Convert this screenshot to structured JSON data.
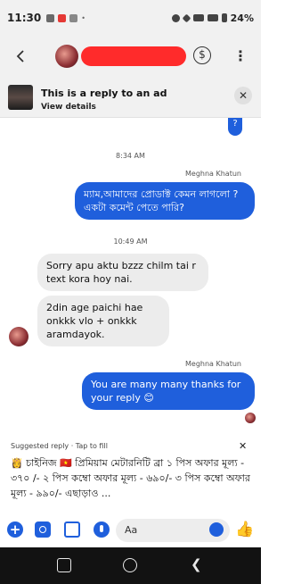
{
  "status_bar": {
    "time": "11:30",
    "battery": "24%"
  },
  "header": {
    "back_icon": "chevron-left-icon",
    "payments_icon": "dollar-circle-icon",
    "more_icon": "more-vertical-icon"
  },
  "ad_banner": {
    "title": "This is a reply to an ad",
    "subtitle": "View details",
    "close_glyph": "✕"
  },
  "messages": {
    "partial_bubble": "?",
    "time_1": "8:34 AM",
    "sender_1": "Meghna Khatun",
    "out_1": "ম্যাম,আমাদের প্রোডাক্ট কেমন লাগলো ?একটা কমেন্ট পেতে পারি?",
    "time_2": "10:49 AM",
    "in_1": "Sorry apu aktu bzzz chilm tai r text kora hoy nai.",
    "in_2": "2din age paichi hae onkkk vlo + onkkk aramdayok.",
    "sender_2": "Meghna Khatun",
    "out_2": "You are many many thanks for your reply 😊"
  },
  "suggested_reply": {
    "label": "Suggested reply · Tap to fill",
    "close_glyph": "✕",
    "text": "👸 চাইনিজ 🇻🇳 প্রিমিয়াম মেটারনিটি ব্রা ১ পিস অফার মূল্য - ৩৭০ /- ২ পিস কম্বো অফার মূল্য - ৬৯০/- ৩ পিস কম্বো অফার মূল্য - ৯৯০/- এছাড়াও ..."
  },
  "composer": {
    "placeholder": "Aa",
    "plus_glyph": "+",
    "like_glyph": "👍"
  },
  "colors": {
    "accent": "#1f5fdc",
    "incoming_bubble": "#ececec",
    "status_bar_bg": "#f1f1f1",
    "name_redaction": "#ff2b2b"
  }
}
